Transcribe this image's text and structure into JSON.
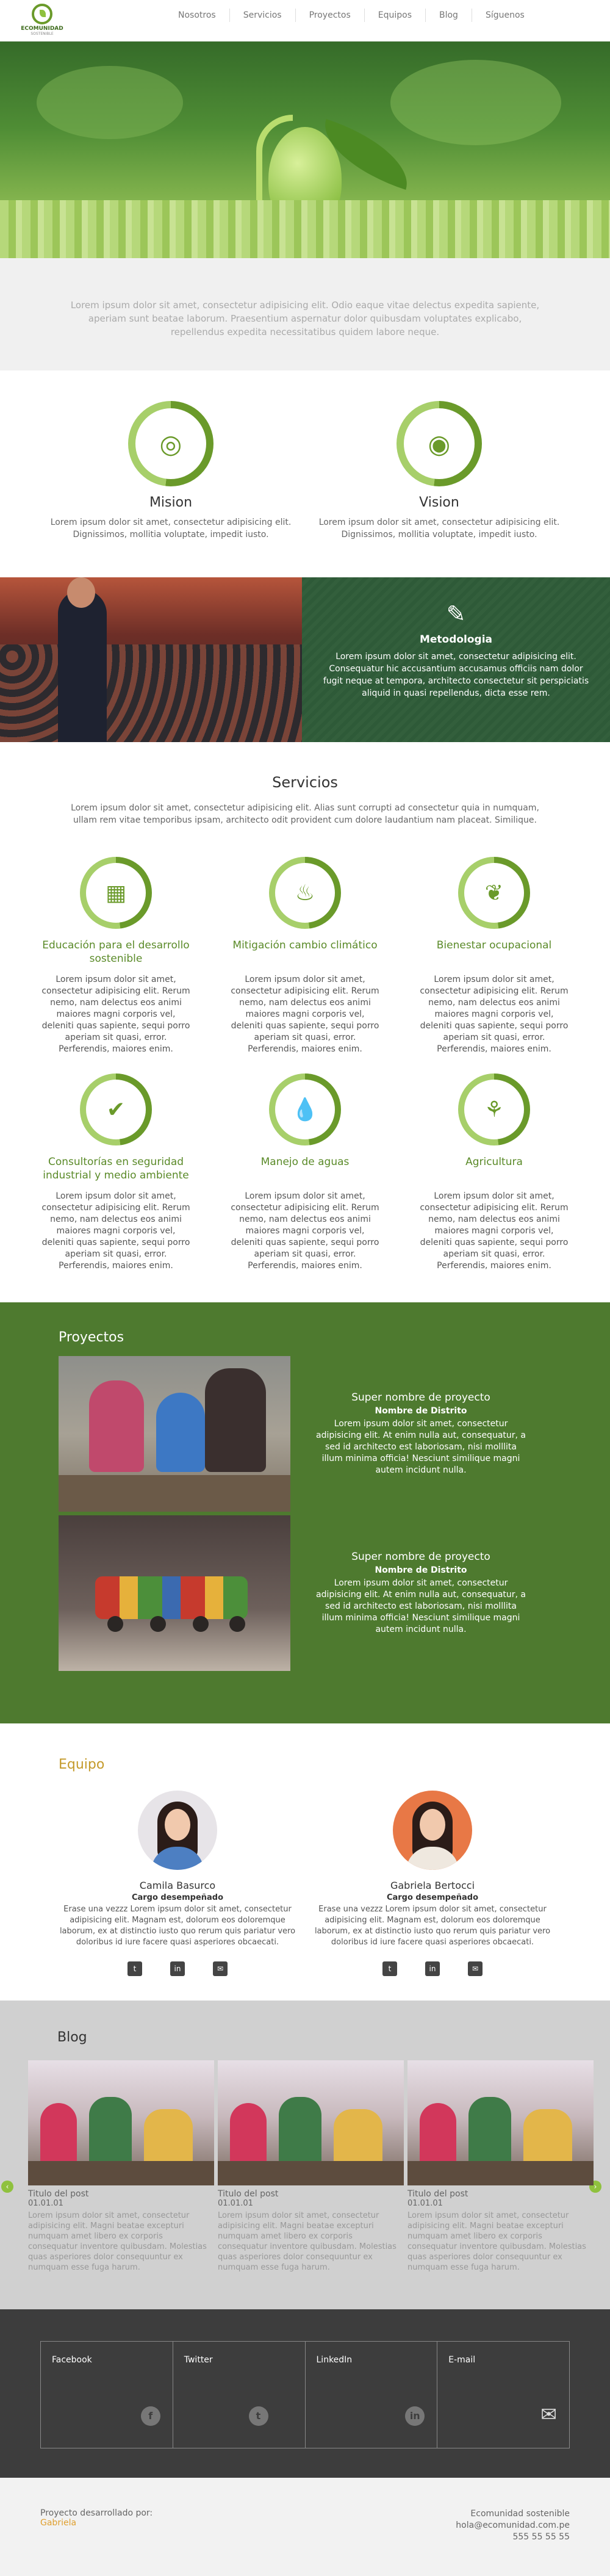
{
  "header": {
    "logo_name": "ECOMUNIDAD",
    "logo_sub": "SOSTENIBLE",
    "nav": [
      "Nosotros",
      "Servicios",
      "Proyectos",
      "Equipos",
      "Blog",
      "Síguenos"
    ]
  },
  "intro": {
    "text": "Lorem ipsum dolor sit amet, consectetur adipisicing elit. Odio eaque vitae delectus expedita sapiente, aperiam sunt beatae laborum. Praesentium aspernatur dolor quibusdam voluptates explicabo, repellendus expedita necessitatibus quidem labore neque."
  },
  "mission": {
    "title": "Mision",
    "text": "Lorem ipsum dolor sit amet, consectetur adipisicing elit. Dignissimos, mollitia voluptate, impedit iusto.",
    "icon": "target-icon"
  },
  "vision": {
    "title": "Vision",
    "text": "Lorem ipsum dolor sit amet, consectetur adipisicing elit. Dignissimos, mollitia voluptate, impedit iusto.",
    "icon": "eye-icon"
  },
  "methodology": {
    "title": "Metodologia",
    "text": "Lorem ipsum dolor sit amet, consectetur adipisicing elit. Consequatur hic accusantium accusamus officiis nam dolor fugit neque at tempora, architecto consectetur sit perspiciatis aliquid in quasi repellendus, dicta esse rem.",
    "icon": "notepad-icon"
  },
  "services": {
    "title": "Servicios",
    "lead": "Lorem ipsum dolor sit amet, consectetur adipisicing elit. Alias sunt corrupti ad consectetur quia in numquam, ullam rem vitae temporibus ipsam, architecto odit provident cum dolore laudantium nam placeat. Similique.",
    "items": [
      {
        "title": "Educación para el desarrollo sostenible",
        "icon": "presentation-icon",
        "text": "Lorem ipsum dolor sit amet, consectetur adipisicing elit. Rerum nemo, nam delectus eos animi maiores magni corporis vel, deleniti quas sapiente, sequi porro aperiam sit quasi, error. Perferendis, maiores enim."
      },
      {
        "title": "Mitigación cambio climático",
        "icon": "hand-flame-icon",
        "text": "Lorem ipsum dolor sit amet, consectetur adipisicing elit. Rerum nemo, nam delectus eos animi maiores magni corporis vel, deleniti quas sapiente, sequi porro aperiam sit quasi, error. Perferendis, maiores enim."
      },
      {
        "title": "Bienestar ocupacional",
        "icon": "hand-plant-icon",
        "text": "Lorem ipsum dolor sit amet, consectetur adipisicing elit. Rerum nemo, nam delectus eos animi maiores magni corporis vel, deleniti quas sapiente, sequi porro aperiam sit quasi, error. Perferendis, maiores enim."
      },
      {
        "title": "Consultorías en seguridad industrial y medio ambiente",
        "icon": "shield-check-icon",
        "text": "Lorem ipsum dolor sit amet, consectetur adipisicing elit. Rerum nemo, nam delectus eos animi maiores magni corporis vel, deleniti quas sapiente, sequi porro aperiam sit quasi, error. Perferendis, maiores enim."
      },
      {
        "title": "Manejo de aguas",
        "icon": "water-drop-icon",
        "text": "Lorem ipsum dolor sit amet, consectetur adipisicing elit. Rerum nemo, nam delectus eos animi maiores magni corporis vel, deleniti quas sapiente, sequi porro aperiam sit quasi, error. Perferendis, maiores enim."
      },
      {
        "title": "Agricultura",
        "icon": "wheat-icon",
        "text": "Lorem ipsum dolor sit amet, consectetur adipisicing elit. Rerum nemo, nam delectus eos animi maiores magni corporis vel, deleniti quas sapiente, sequi porro aperiam sit quasi, error. Perferendis, maiores enim."
      }
    ]
  },
  "projects": {
    "title": "Proyectos",
    "items": [
      {
        "title": "Super nombre de proyecto",
        "district": "Nombre de Distrito",
        "text": "Lorem ipsum dolor sit amet, consectetur adipisicing elit. At enim nulla aut, consequatur, a sed id architecto est laboriosam, nisi molllita illum minima officia! Nesciunt similique magni autem incidunt nulla."
      },
      {
        "title": "Super nombre de proyecto",
        "district": "Nombre de Distrito",
        "text": "Lorem ipsum dolor sit amet, consectetur adipisicing elit. At enim nulla aut, consequatur, a sed id architecto est laboriosam, nisi molllita illum minima officia! Nesciunt similique magni autem incidunt nulla."
      }
    ]
  },
  "team": {
    "title": "Equipo",
    "members": [
      {
        "name": "Camila Basurco",
        "role": "Cargo desempeñado",
        "text": "Erase una vezzz Lorem ipsum dolor sit amet, consectetur adipisicing elit. Magnam est, dolorum eos doloremque laborum, ex at distinctio iusto quo rerum quis pariatur vero doloribus id iure facere quasi asperiores obcaecati."
      },
      {
        "name": "Gabriela Bertocci",
        "role": "Cargo desempeñado",
        "text": "Erase una vezzz Lorem ipsum dolor sit amet, consectetur adipisicing elit. Magnam est, dolorum eos doloremque laborum, ex at distinctio iusto quo rerum quis pariatur vero doloribus id iure facere quasi asperiores obcaecati."
      }
    ],
    "social_icons": [
      "twitter-icon",
      "linkedin-icon",
      "mail-icon"
    ]
  },
  "blog": {
    "title": "Blog",
    "posts": [
      {
        "title": "Titulo del post",
        "date": "01.01.01",
        "text": "Lorem ipsum dolor sit amet, consectetur adipisicing elit. Magni beatae excepturi numquam amet libero ex corporis consequatur inventore quibusdam. Molestias quas asperiores dolor consequuntur ex numquam esse fuga harum."
      },
      {
        "title": "Titulo del post",
        "date": "01.01.01",
        "text": "Lorem ipsum dolor sit amet, consectetur adipisicing elit. Magni beatae excepturi numquam amet libero ex corporis consequatur inventore quibusdam. Molestias quas asperiores dolor consequuntur ex numquam esse fuga harum."
      },
      {
        "title": "Titulo del post",
        "date": "01.01.01",
        "text": "Lorem ipsum dolor sit amet, consectetur adipisicing elit. Magni beatae excepturi numquam amet libero ex corporis consequatur inventore quibusdam. Molestias quas asperiores dolor consequuntur ex numquam esse fuga harum."
      }
    ]
  },
  "footer": {
    "cols": [
      {
        "label": "Facebook",
        "icon": "facebook-icon"
      },
      {
        "label": "Twitter",
        "icon": "twitter-icon"
      },
      {
        "label": "LinkedIn",
        "icon": "linkedin-icon"
      },
      {
        "label": "E-mail",
        "icon": "envelope-icon"
      }
    ],
    "credit_label": "Proyecto desarrollado por:",
    "credit_name": "Gabriela",
    "org": "Ecomunidad sostenible",
    "email": "hola@ecomunidad.com.pe",
    "phone": "555 55 55 55"
  },
  "colors": {
    "green": "#6a9a2a",
    "dark_green": "#4e7a2f",
    "accent": "#c49a2a"
  }
}
